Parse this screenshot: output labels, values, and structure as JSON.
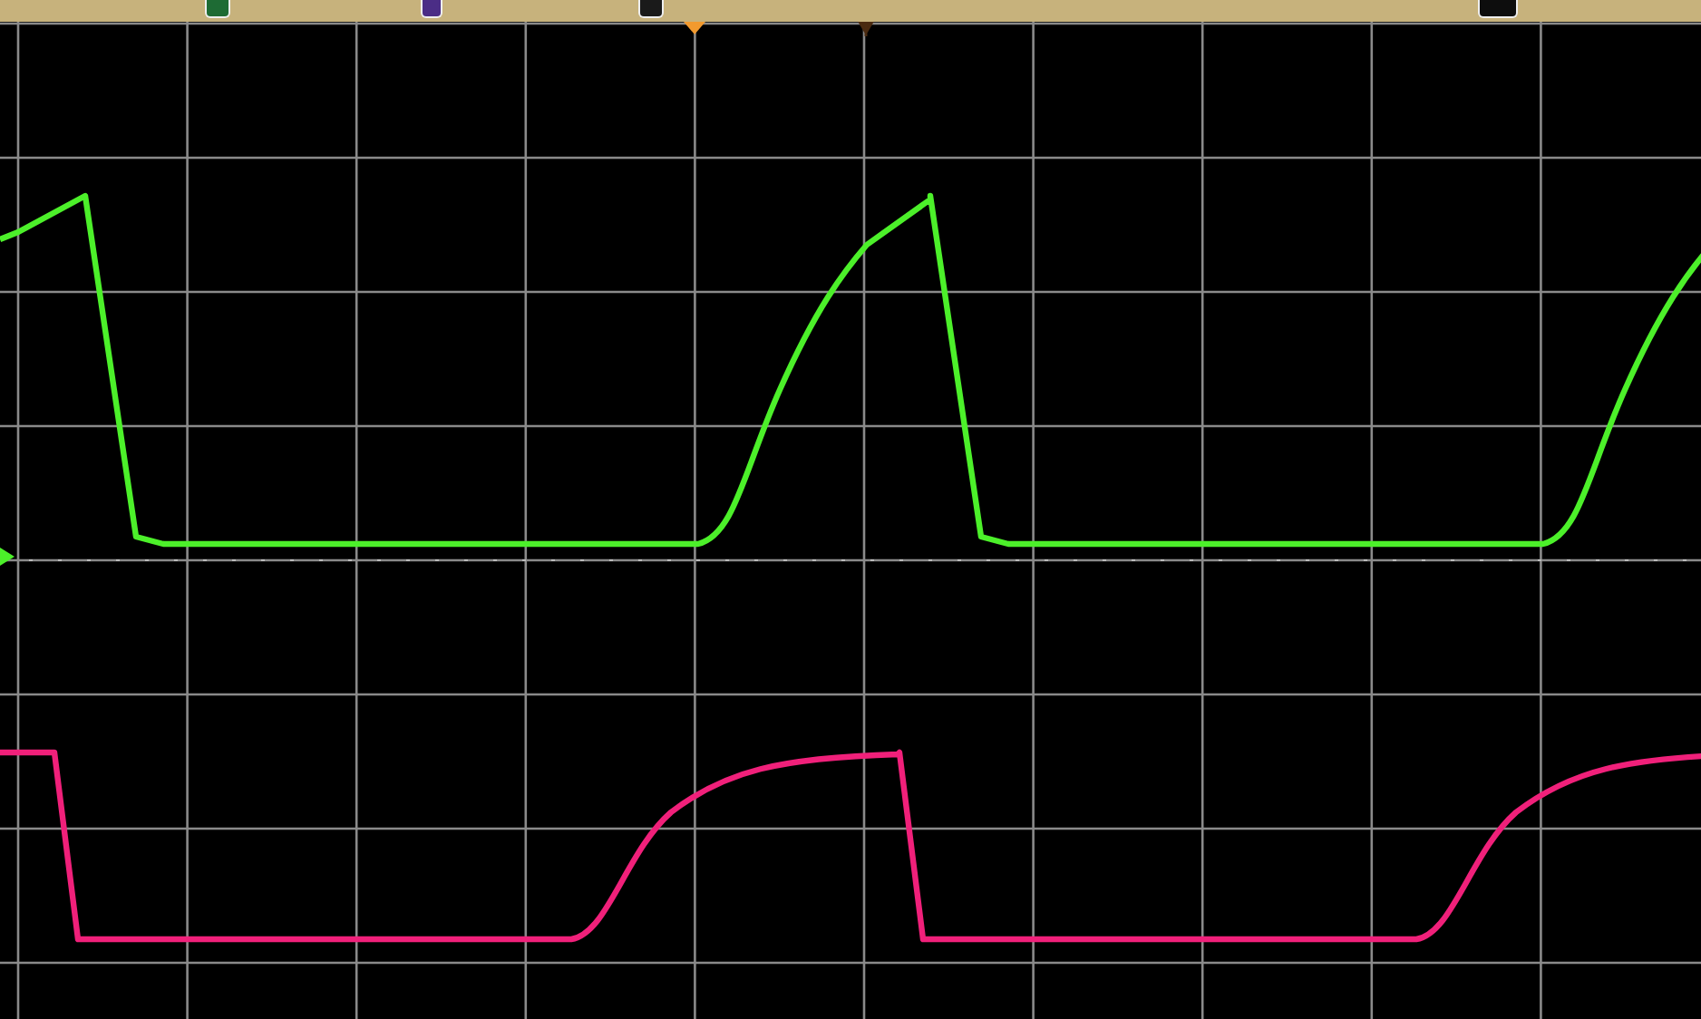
{
  "top_bar": {
    "channel_tags": [
      {
        "color": "#1e6b34"
      },
      {
        "color": "#4b2d86"
      },
      {
        "color": "#1a1a1a"
      },
      {
        "color": "#0d0d0d"
      }
    ]
  },
  "traces": [
    {
      "kind": "sawtooth",
      "color": "#4cf02a"
    },
    {
      "kind": "rounded-square",
      "color": "#f0207a"
    }
  ]
}
